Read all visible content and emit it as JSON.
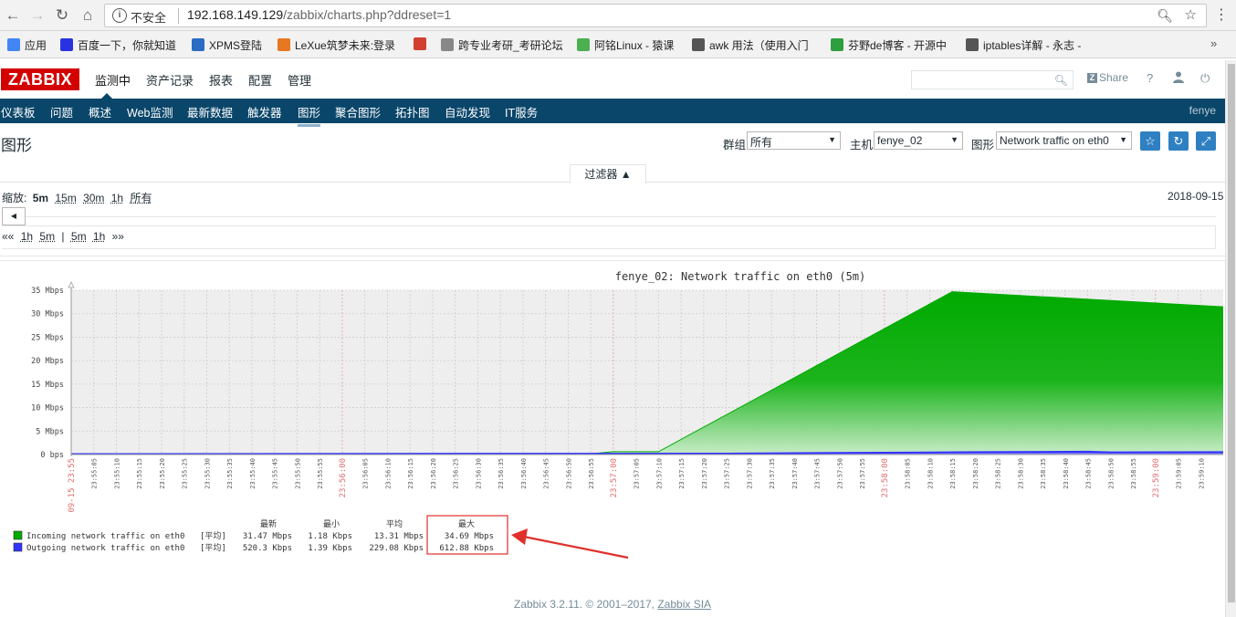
{
  "browser": {
    "insecure_label": "不安全",
    "url_host": "192.168.149.129",
    "url_path": "/zabbix/charts.php?ddreset=1",
    "bookmarks": [
      {
        "label": "应用",
        "color": "#4285f4"
      },
      {
        "label": "百度一下，你就知道",
        "color": "#2932e1"
      },
      {
        "label": "XPMS登陆",
        "color": "#2b6cc4"
      },
      {
        "label": "LeXue筑梦未来:登录",
        "color": "#e87722"
      },
      {
        "label": "",
        "color": "#d23f31"
      },
      {
        "label": "跨专业考研_考研论坛",
        "color": "#888888"
      },
      {
        "label": "阿铭Linux - 猿课",
        "color": "#4caf50"
      },
      {
        "label": "awk 用法（使用入门",
        "color": "#555555"
      },
      {
        "label": "芬野de博客 - 开源中",
        "color": "#2e9e3e"
      },
      {
        "label": "iptables详解 - 永志 -",
        "color": "#555555"
      }
    ],
    "bookmarks_more": "»"
  },
  "header": {
    "logo": "ZABBIX",
    "menu": [
      "监测中",
      "资产记录",
      "报表",
      "配置",
      "管理"
    ],
    "share": "Share",
    "help": "?",
    "colors": {
      "logo": "#d40000",
      "subnav": "#0a466a",
      "button": "#2f80c2"
    }
  },
  "subnav": {
    "items": [
      "仪表板",
      "问题",
      "概述",
      "Web监测",
      "最新数据",
      "触发器",
      "图形",
      "聚合图形",
      "拓扑图",
      "自动发现",
      "IT服务"
    ],
    "active": "图形",
    "user": "fenye"
  },
  "page": {
    "title": "图形"
  },
  "filters": {
    "group_label": "群组",
    "group_value": "所有",
    "host_label": "主机",
    "host_value": "fenye_02",
    "graph_label": "图形",
    "graph_value": "Network traffic on eth0"
  },
  "filter_tab": "过滤器 ▲",
  "timebar": {
    "zoom_label": "缩放:",
    "zoom_options": [
      "5m",
      "15m",
      "30m",
      "1h",
      "所有"
    ],
    "date": "2018-09-15",
    "nav_back": "««",
    "nav_fwd": "»»",
    "nav_left": [
      "1h",
      "5m"
    ],
    "nav_sep": "|",
    "nav_right": [
      "5m",
      "1h"
    ]
  },
  "chart_data": {
    "type": "area",
    "title": "fenye_02: Network traffic on eth0 (5m)",
    "y_unit": "Mbps",
    "ylim": [
      0,
      35
    ],
    "y_ticks": [
      "35 Mbps",
      "30 Mbps",
      "25 Mbps",
      "20 Mbps",
      "15 Mbps",
      "10 Mbps",
      "5 Mbps",
      "0 bps"
    ],
    "x_ticks": [
      "09-15 23:55",
      "23:55:05",
      "23:55:10",
      "23:55:15",
      "23:55:20",
      "23:55:25",
      "23:55:30",
      "23:55:35",
      "23:55:40",
      "23:55:45",
      "23:55:50",
      "23:55:55",
      "23:56:00",
      "23:56:05",
      "23:56:10",
      "23:56:15",
      "23:56:20",
      "23:56:25",
      "23:56:30",
      "23:56:35",
      "23:56:40",
      "23:56:45",
      "23:56:50",
      "23:56:55",
      "23:57:00",
      "23:57:05",
      "23:57:10",
      "23:57:15",
      "23:57:20",
      "23:57:25",
      "23:57:30",
      "23:57:35",
      "23:57:40",
      "23:57:45",
      "23:57:50",
      "23:57:55",
      "23:58:00",
      "23:58:05",
      "23:58:10",
      "23:58:15",
      "23:58:20",
      "23:58:25",
      "23:58:30",
      "23:58:35",
      "23:58:40",
      "23:58:45",
      "23:58:50",
      "23:58:55",
      "23:59:00",
      "23:59:05",
      "23:59:10"
    ],
    "x_highlight": [
      "09-15 23:55",
      "23:56:00",
      "23:57:00",
      "23:58:00",
      "23:59:00"
    ],
    "grid": true,
    "series": [
      {
        "name": "Incoming network traffic on eth0",
        "color": "#00aa00",
        "x": [
          "23:55:00",
          "23:56:25",
          "23:56:30",
          "23:56:55",
          "23:57:00",
          "23:57:10",
          "23:58:15",
          "23:59:15"
        ],
        "values": [
          0.0,
          0.0,
          0.15,
          0.15,
          0.6,
          0.6,
          34.69,
          31.47
        ]
      },
      {
        "name": "Outgoing network traffic on eth0",
        "color": "#3333ff",
        "x": [
          "23:55:00",
          "23:57:25",
          "23:58:00",
          "23:58:20",
          "23:58:45",
          "23:58:50",
          "23:59:15"
        ],
        "values": [
          0.1,
          0.2,
          0.4,
          0.5,
          0.6,
          0.45,
          0.52
        ]
      }
    ],
    "legend": {
      "headers": [
        "最新",
        "最小",
        "平均",
        "最大"
      ],
      "rows": [
        {
          "label": "Incoming network traffic on eth0",
          "func": "[平均]",
          "last": "31.47 Mbps",
          "min": "1.18 Kbps",
          "avg": "13.31 Mbps",
          "max": "34.69 Mbps"
        },
        {
          "label": "Outgoing network traffic on eth0",
          "func": "[平均]",
          "last": "520.3 Kbps",
          "min": "1.39 Kbps",
          "avg": "229.08 Kbps",
          "max": "612.88 Kbps"
        }
      ]
    }
  },
  "footer": {
    "text": "Zabbix 3.2.11. © 2001–2017, ",
    "link": "Zabbix SIA"
  }
}
